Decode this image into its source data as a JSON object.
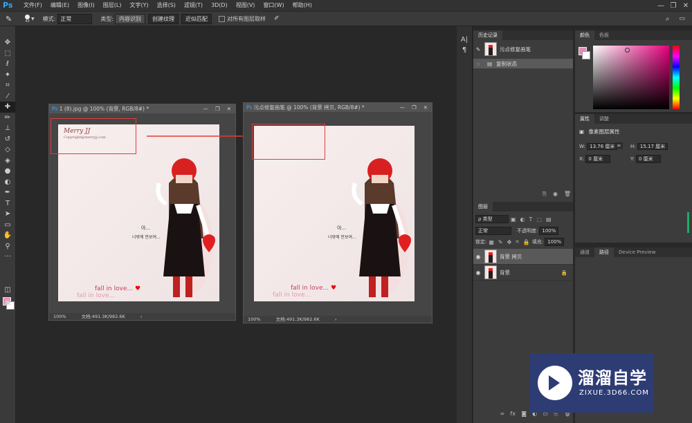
{
  "menubar": {
    "logo": "Ps",
    "items": [
      "文件(F)",
      "编辑(E)",
      "图像(I)",
      "图层(L)",
      "文字(Y)",
      "选择(S)",
      "滤镜(T)",
      "3D(D)",
      "视图(V)",
      "窗口(W)",
      "帮助(H)"
    ],
    "minimize": "—",
    "restore": "❐",
    "close": "✕"
  },
  "options": {
    "brush_size": "40",
    "mode_label": "模式:",
    "mode_value": "正常",
    "type_label": "类型:",
    "type_buttons": [
      "内容识别",
      "创建纹理",
      "近似匹配"
    ],
    "sample_all_label": "对所有图层取样"
  },
  "doc1": {
    "title": "1 (8).jpg @ 100% (背景, RGB/8#) *",
    "zoom": "100%",
    "status": "文档:491.3K/982.6K",
    "watermark_title": "Merry JJ",
    "watermark_sub": "Copyright@merryjj.com"
  },
  "doc2": {
    "title": "污点修复画笔 @ 100% (背景 拷贝, RGB/8#) *",
    "zoom": "100%",
    "status": "文档:491.3K/982.6K"
  },
  "artwork": {
    "caption1": "fall in love...",
    "caption2": "fall in love...",
    "heart": "♥",
    "korean1": "아...",
    "korean2": "너밖에 안보여..."
  },
  "history": {
    "tab": "历史记录",
    "items": [
      {
        "label": "污点修复画笔"
      },
      {
        "label": "复制状态"
      }
    ]
  },
  "color": {
    "tabs": [
      "颜色",
      "色板"
    ],
    "fg": "#e48bb7",
    "bg": "#ffffff"
  },
  "properties": {
    "tabs": [
      "属性",
      "调整"
    ],
    "title": "像素图层属性",
    "w_label": "W:",
    "w_value": "13.76 厘米",
    "h_label": "H:",
    "h_value": "15.17 厘米",
    "x_label": "X:",
    "x_value": "0 厘米",
    "y_label": "Y:",
    "y_value": "0 厘米"
  },
  "layers": {
    "tab": "图层",
    "filter_value": "ρ 类型",
    "blend_mode": "正常",
    "opacity_label": "不透明度:",
    "opacity_value": "100%",
    "lock_label": "锁定:",
    "fill_label": "填充:",
    "fill_value": "100%",
    "rows": [
      {
        "name": "背景 拷贝"
      },
      {
        "name": "背景"
      }
    ]
  },
  "channels": {
    "tabs": [
      "通道",
      "路径",
      "Device Preview"
    ]
  },
  "brand": {
    "name": "溜溜自学",
    "url": "ZIXUE.3D66.COM"
  }
}
